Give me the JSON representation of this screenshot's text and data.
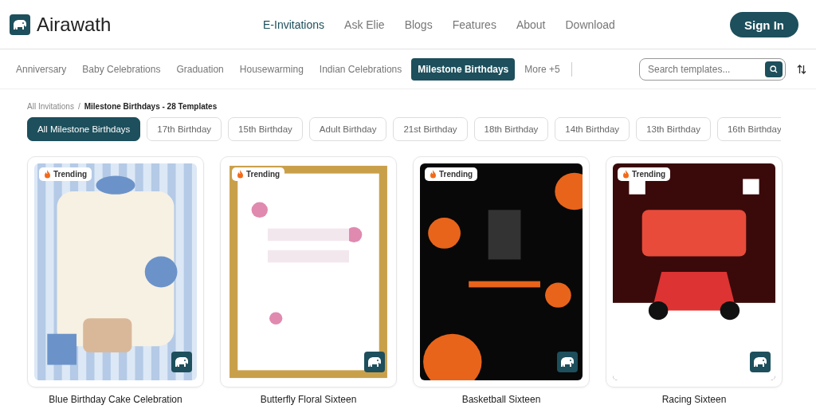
{
  "header": {
    "brand": "Airawath",
    "nav": [
      {
        "label": "E-Invitations",
        "selected": true
      },
      {
        "label": "Ask Elie",
        "selected": false
      },
      {
        "label": "Blogs",
        "selected": false
      },
      {
        "label": "Features",
        "selected": false
      },
      {
        "label": "About",
        "selected": false
      },
      {
        "label": "Download",
        "selected": false
      }
    ],
    "sign_in": "Sign In"
  },
  "categories": [
    {
      "label": "Anniversary",
      "selected": false
    },
    {
      "label": "Baby Celebrations",
      "selected": false
    },
    {
      "label": "Graduation",
      "selected": false
    },
    {
      "label": "Housewarming",
      "selected": false
    },
    {
      "label": "Indian Celebrations",
      "selected": false
    },
    {
      "label": "Milestone Birthdays",
      "selected": true
    },
    {
      "label": "More +5",
      "selected": false
    }
  ],
  "search": {
    "placeholder": "Search templates..."
  },
  "breadcrumb": {
    "parent": "All Invitations",
    "separator": "/",
    "current": "Milestone Birthdays - 28 Templates"
  },
  "filters": [
    {
      "label": "All Milestone Birthdays",
      "selected": true
    },
    {
      "label": "17th Birthday",
      "selected": false
    },
    {
      "label": "15th Birthday",
      "selected": false
    },
    {
      "label": "Adult Birthday",
      "selected": false
    },
    {
      "label": "21st Birthday",
      "selected": false
    },
    {
      "label": "18th Birthday",
      "selected": false
    },
    {
      "label": "14th Birthday",
      "selected": false
    },
    {
      "label": "13th Birthday",
      "selected": false
    },
    {
      "label": "16th Birthday",
      "selected": false
    }
  ],
  "templates": [
    {
      "title": "Blue Birthday Cake Celebration",
      "badge": "Trending",
      "kind": "picture"
    },
    {
      "title": "Butterfly Floral Sixteen",
      "badge": "Trending",
      "kind": "picture"
    },
    {
      "title": "Basketball Sixteen",
      "badge": "Trending",
      "kind": "picture"
    },
    {
      "title": "Racing Sixteen",
      "badge": "Trending",
      "kind": "picture"
    }
  ]
}
